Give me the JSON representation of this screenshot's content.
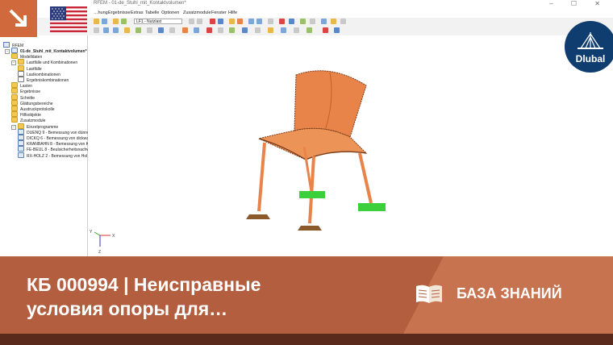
{
  "window": {
    "title": "RFEM - 01-de_Stuhl_mit_Kontaktvolumen*",
    "buttons": [
      "–",
      "☐",
      "✕"
    ]
  },
  "menubar": {
    "items": [
      "…hung",
      "Ergebnisse",
      "Extras",
      "Tabelle",
      "Optionen",
      "Zusatzmodule",
      "Fenster",
      "Hilfe"
    ]
  },
  "toolbar": {
    "load_case": "LF1 - Nutzlast"
  },
  "navigator": {
    "root_label": "RFEM",
    "items": [
      {
        "label": "01-de_Stuhl_mit_Kontaktvolumen*",
        "level": 0,
        "icon": "project-icon",
        "bold": true
      },
      {
        "label": "Modelldaten",
        "level": 1,
        "icon": "folder-icon"
      },
      {
        "label": "Lastfälle und Kombinationen",
        "level": 1,
        "icon": "folder-icon"
      },
      {
        "label": "Lastfälle",
        "level": 2,
        "icon": "folder-icon"
      },
      {
        "label": "Lastkombinationen",
        "level": 2,
        "icon": "doc-icon"
      },
      {
        "label": "Ergebniskombinationen",
        "level": 2,
        "icon": "doc-icon"
      },
      {
        "label": "Lasten",
        "level": 1,
        "icon": "folder-icon"
      },
      {
        "label": "Ergebnisse",
        "level": 1,
        "icon": "folder-icon"
      },
      {
        "label": "Schnitte",
        "level": 1,
        "icon": "folder-icon"
      },
      {
        "label": "Glättungsbereiche",
        "level": 1,
        "icon": "folder-icon"
      },
      {
        "label": "Ausdruckprotokolle",
        "level": 1,
        "icon": "folder-icon"
      },
      {
        "label": "Hilfsobjekte",
        "level": 1,
        "icon": "folder-icon"
      },
      {
        "label": "Zusatzmodule",
        "level": 1,
        "icon": "folder-icon"
      },
      {
        "label": "Einzelprogramme",
        "level": 1,
        "icon": "folder-icon"
      },
      {
        "label": "DUENQ 9 - Bemessung von dünnw",
        "level": 2,
        "icon": "module-icon"
      },
      {
        "label": "DICKQ 6 - Bemessung von dickwa",
        "level": 2,
        "icon": "module-icon"
      },
      {
        "label": "KRANBAHN 8 - Bemessung von K",
        "level": 2,
        "icon": "module-icon"
      },
      {
        "label": "FE-BEUL 8 - Beulsicherheitsnachw",
        "level": 2,
        "icon": "module-icon"
      },
      {
        "label": "RX-HOLZ 2 - Bemessung von Hol",
        "level": 2,
        "icon": "module-icon"
      }
    ]
  },
  "axes": {
    "x": "X",
    "y": "Y",
    "z": "Z"
  },
  "brand": {
    "name": "Dlubal",
    "color": "#0f3d6f"
  },
  "colors": {
    "accent": "#d0693c",
    "banner": "#b35f3f",
    "model": "#e8844a",
    "support": "#3ccf3c"
  },
  "banner": {
    "title_line1": "КБ 000994 | Неисправные",
    "title_line2": "условия опоры для…",
    "category": "БАЗА ЗНАНИЙ"
  }
}
